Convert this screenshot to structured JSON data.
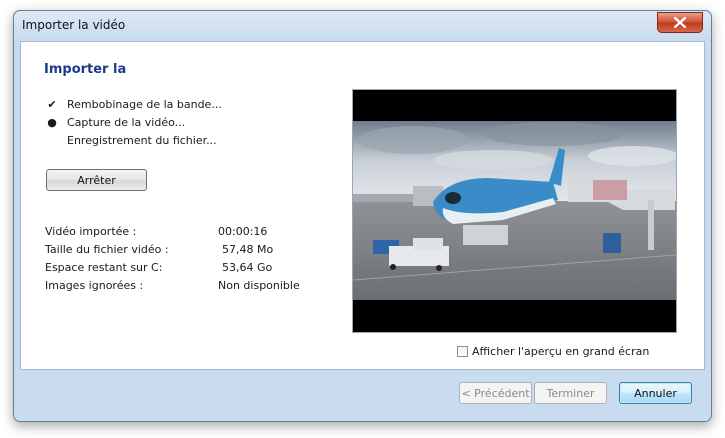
{
  "window": {
    "title": "Importer la vidéo"
  },
  "heading": "Importer la",
  "steps": [
    {
      "status": "done",
      "symbol": "✔",
      "label": "Rembobinage de la bande..."
    },
    {
      "status": "current",
      "symbol": "●",
      "label": "Capture de la vidéo..."
    },
    {
      "status": "pending",
      "symbol": "",
      "label": "Enregistrement du fichier..."
    }
  ],
  "stop_button": "Arrêter",
  "stats": [
    {
      "label": "Vidéo importée :",
      "value": "00:00:16"
    },
    {
      "label": "Taille du fichier vidéo :",
      "value": "57,48 Mo"
    },
    {
      "label": "Espace restant sur C:",
      "value": "53,64 Go"
    },
    {
      "label": "Images ignorées :",
      "value": "Non disponible"
    }
  ],
  "preview": {
    "description_icon": "video-frame-airplane-at-gate"
  },
  "fullscreen_checkbox": {
    "label": "Afficher l'aperçu en grand écran",
    "checked": false
  },
  "footer": {
    "previous": "< Précédent",
    "finish": "Terminer",
    "cancel": "Annuler"
  },
  "colors": {
    "heading": "#1e3a8a",
    "close": "#c23a1f",
    "frame": "#c9dbef"
  }
}
